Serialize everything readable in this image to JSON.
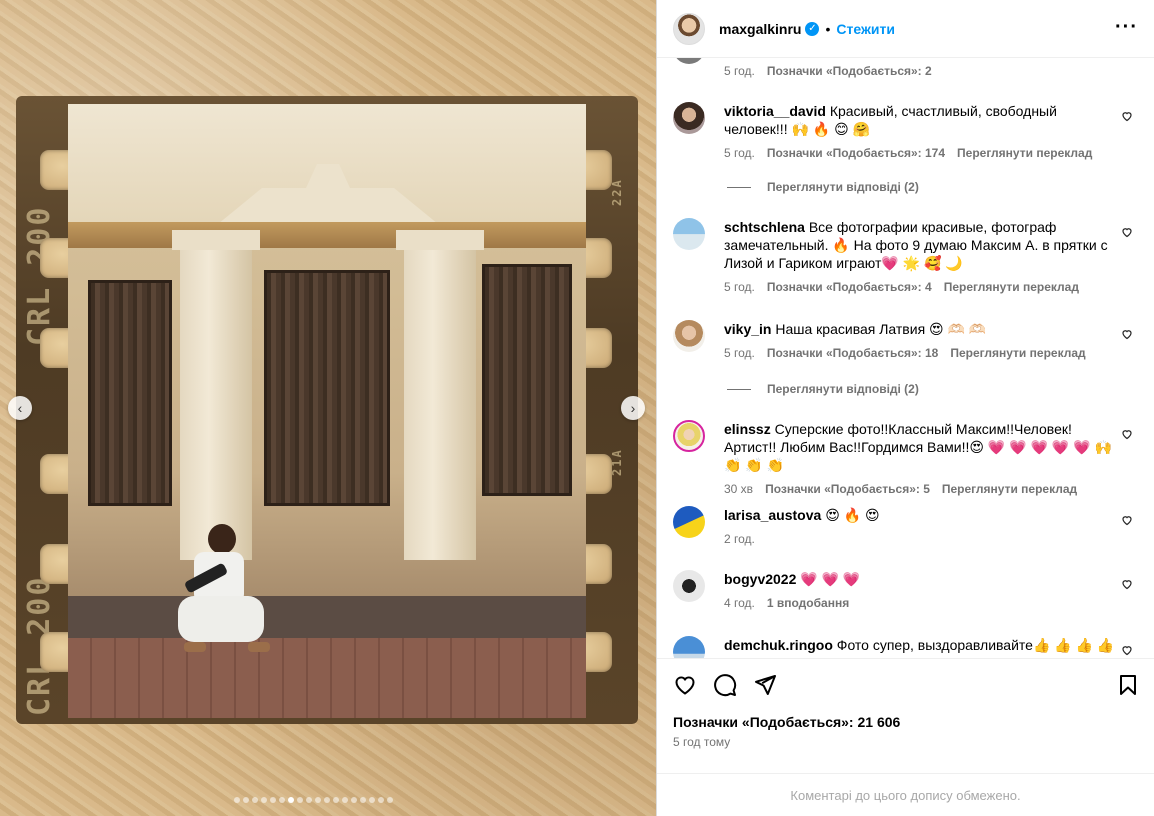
{
  "post": {
    "username": "maxgalkinru",
    "verified_icon": "✓",
    "separator": "•",
    "follow_label": "Стежити",
    "more_label": "···",
    "likes_text": "Позначки «Подобається»: 21 606",
    "time_text": "5 год тому",
    "comments_limited_text": "Коментарі до цього допису обмежено."
  },
  "media": {
    "film_label_left": "CRL 200",
    "film_label_left2": "CRL 200",
    "film_label_right_top": "22A",
    "film_label_right_mid": "21A",
    "prev_label": "‹",
    "next_label": "›",
    "dot_count": 18,
    "active_dot": 6
  },
  "comments": [
    {
      "username": "",
      "text": "",
      "time": "5 год.",
      "likes": "Позначки «Подобається»: 2",
      "translate": ""
    },
    {
      "username": "viktoria__david",
      "text": "Красивый, счастливый, свободный человек!!! 🙌 🔥 😊 🤗",
      "time": "5 год.",
      "likes": "Позначки «Подобається»: 174",
      "translate": "Переглянути переклад"
    },
    {
      "username": "schtschlena",
      "text": "Все фотографии красивые, фотограф замечательный. 🔥 На фото 9 думаю Максим А. в прятки с Лизой и Гариком играют💗 🌟 🥰 🌙",
      "time": "5 год.",
      "likes": "Позначки «Подобається»: 4",
      "translate": "Переглянути переклад"
    },
    {
      "username": "viky_in",
      "text": "Наша красивая Латвия 😍 🫶🏻 🫶🏻",
      "time": "5 год.",
      "likes": "Позначки «Подобається»: 18",
      "translate": "Переглянути переклад"
    },
    {
      "username": "elinssz",
      "text": "Суперские фото!!Классный Максим!!Человек!Артист!! Любим Вас!!Гордимся Вами!!😍 💗 💗 💗 💗 💗 🙌 👏 👏 👏",
      "time": "30 хв",
      "likes": "Позначки «Подобається»: 5",
      "translate": "Переглянути переклад"
    },
    {
      "username": "larisa_austova",
      "text": "😍 🔥 😍",
      "time": "2 год.",
      "likes": "",
      "translate": ""
    },
    {
      "username": "bogyv2022",
      "text": "💗 💗 💗",
      "time": "4 год.",
      "likes": "1 вподобання",
      "translate": ""
    },
    {
      "username": "demchuk.ringoo",
      "text": "Фото супер, выздоравливайте👍 👍 👍 👍",
      "time": "",
      "likes": "",
      "translate": ""
    }
  ],
  "replies": [
    {
      "label": "Переглянути відповіді (2)"
    },
    {
      "label": "Переглянути відповіді (2)"
    }
  ],
  "icons": {
    "like": "heart-icon",
    "comment": "comment-icon",
    "share": "share-icon",
    "save": "bookmark-icon"
  },
  "colors": {
    "accent": "#0095f6",
    "secondary_text": "#737373",
    "border": "#dbdbdb"
  }
}
